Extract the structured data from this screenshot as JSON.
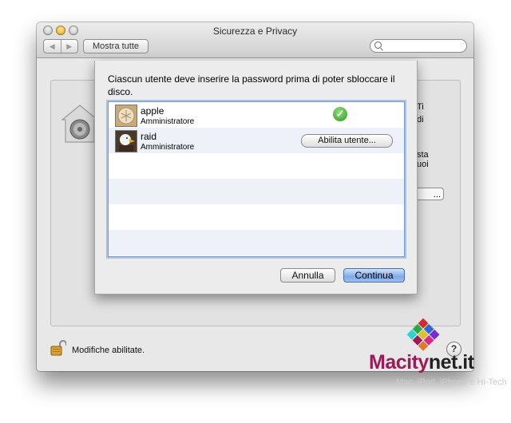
{
  "window": {
    "title": "Sicurezza e Privacy",
    "nav_back": "◀",
    "nav_forward": "▶",
    "show_all_label": "Mostra tutte",
    "search_placeholder": ""
  },
  "background_pane": {
    "right_text_lines": [
      "Ti",
      "di",
      "sta",
      "uoi"
    ],
    "button_label": "..."
  },
  "sheet": {
    "message": "Ciascun utente deve inserire la password prima di poter sbloccare il disco.",
    "users": [
      {
        "name": "apple",
        "role": "Amministratore",
        "status_icon": "checkmark-icon"
      },
      {
        "name": "raid",
        "role": "Amministratore",
        "action_label": "Abilita utente..."
      }
    ],
    "empty_rows": 4,
    "cancel_label": "Annulla",
    "continue_label": "Continua"
  },
  "footer": {
    "lock_status": "Modifiche abilitate.",
    "help_label": "?"
  },
  "watermark": {
    "brand_part1": "Macity",
    "brand_part2": "net.it",
    "tagline": "Mac, iPod, iPhone e Hi-Tech"
  },
  "colors": {
    "accent_blue": "#7eaae8",
    "brand_magenta": "#9b1b58",
    "success_green": "#2e9a1d"
  }
}
